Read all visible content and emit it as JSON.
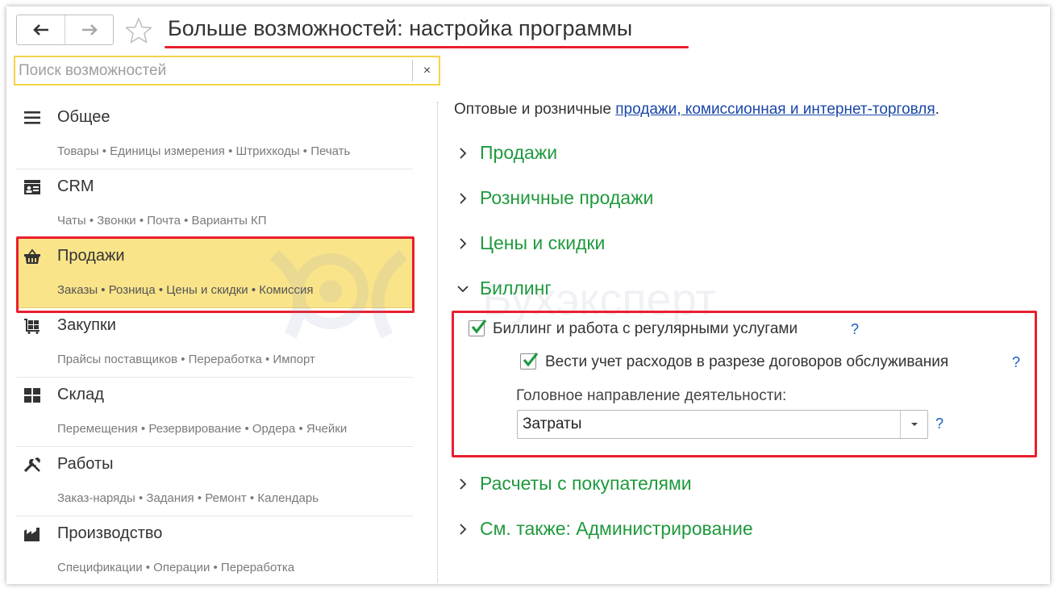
{
  "header": {
    "title": "Больше возможностей: настройка программы",
    "back_icon": "arrow-left-icon",
    "forward_icon": "arrow-right-icon",
    "favorite_icon": "star-icon"
  },
  "search": {
    "placeholder": "Поиск возможностей",
    "value": "",
    "clear_label": "×"
  },
  "categories": [
    {
      "name": "Общее",
      "sub": "Товары • Единицы измерения • Штрихкоды • Печать",
      "icon": "list-icon"
    },
    {
      "name": "CRM",
      "sub": "Чаты • Звонки • Почта • Варианты КП",
      "icon": "contact-card-icon"
    },
    {
      "name": "Продажи",
      "sub": "Заказы • Розница • Цены и скидки • Комиссия",
      "icon": "basket-icon",
      "selected": true
    },
    {
      "name": "Закупки",
      "sub": "Прайсы поставщиков • Переработка • Импорт",
      "icon": "cart-icon"
    },
    {
      "name": "Склад",
      "sub": "Перемещения • Резервирование • Ордера • Ячейки",
      "icon": "warehouse-icon"
    },
    {
      "name": "Работы",
      "sub": "Заказ-наряды • Задания • Ремонт • Календарь",
      "icon": "tools-icon"
    },
    {
      "name": "Производство",
      "sub": "Спецификации • Операции • Переработка",
      "icon": "factory-icon"
    }
  ],
  "main": {
    "intro_text": "Оптовые и розничные ",
    "intro_link": "продажи, комиссионная и интернет-торговля",
    "intro_end": ".",
    "sections": [
      {
        "label": "Продажи",
        "expanded": false
      },
      {
        "label": "Розничные продажи",
        "expanded": false
      },
      {
        "label": "Цены и скидки",
        "expanded": false
      },
      {
        "label": "Биллинг",
        "expanded": true
      },
      {
        "label": "Расчеты с покупателями",
        "expanded": false
      },
      {
        "label": "См. также: Администрирование",
        "expanded": false
      }
    ],
    "billing": {
      "checkbox1_label": "Биллинг и работа с регулярными услугами",
      "checkbox1_checked": true,
      "checkbox2_label": "Вести учет расходов в разрезе договоров обслуживания",
      "checkbox2_checked": true,
      "field_label": "Головное направление деятельности:",
      "field_value": "Затраты",
      "help": "?"
    }
  },
  "watermark": "Бухэксперт",
  "colors": {
    "accent_green": "#1f9a3d",
    "highlight": "#fae48a",
    "annotation_red": "#e8202e",
    "link": "#1a47a8",
    "check": "#1f9a3d"
  }
}
